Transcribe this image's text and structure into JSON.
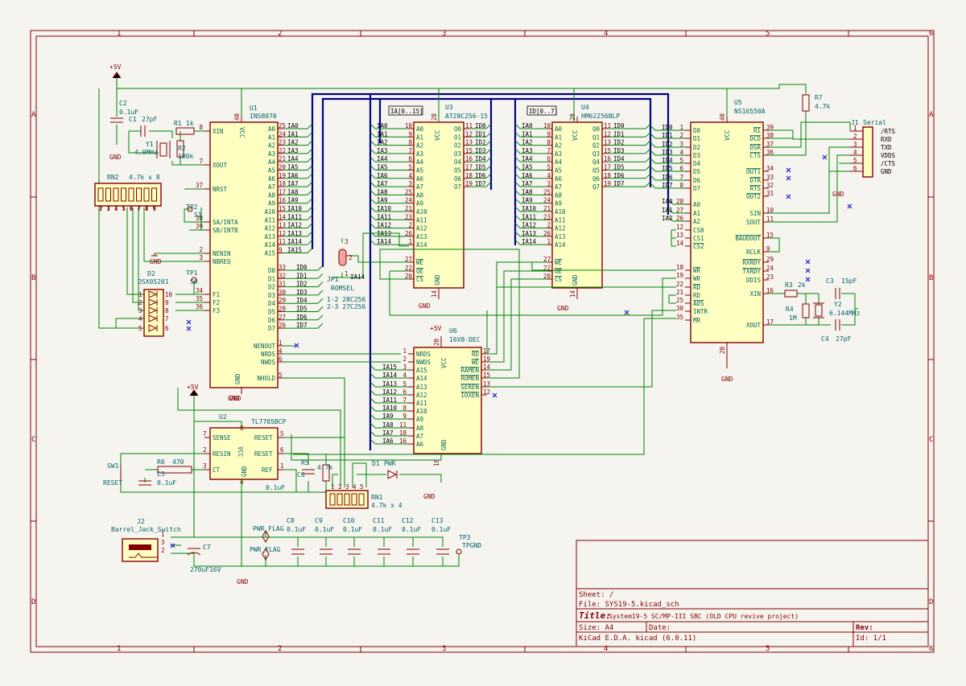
{
  "frame": {
    "columns": [
      "1",
      "2",
      "3",
      "4",
      "5",
      "6"
    ],
    "rows": [
      "A",
      "B",
      "C",
      "D"
    ]
  },
  "title_block": {
    "sheet": "Sheet: /",
    "file": "File: SYS19-5.kicad_sch",
    "title_label": "Title:",
    "title": "System19-5 SC/MP-III SBC (OLD CPU revive project)",
    "size": "Size: A4",
    "date": "Date:",
    "rev": "Rev:",
    "tool": "KiCad E.D.A.  kicad (6.0.11)",
    "id": "Id: 1/1"
  },
  "power": {
    "plus5v": "+5V",
    "gnd": "GND",
    "pwr_flag": "PWR_FLAG"
  },
  "components": {
    "u1": {
      "ref": "U1",
      "value": "INS8070"
    },
    "u3": {
      "ref": "U3",
      "value": "AT28C256-15"
    },
    "u4": {
      "ref": "U4",
      "value": "HM62256BLP"
    },
    "u5": {
      "ref": "U5",
      "value": "NS16550A"
    },
    "u6": {
      "ref": "U6",
      "value": "16V8-DEC"
    },
    "u2": {
      "ref": "U2",
      "value": "TL7705BCP"
    },
    "c1": {
      "ref": "C1",
      "value": "27pF"
    },
    "c2": {
      "ref": "C2",
      "value": "0.1uF"
    },
    "r1": {
      "ref": "R1",
      "value": "1k"
    },
    "r2": {
      "ref": "R2",
      "value": "100k"
    },
    "y1": {
      "ref": "Y1",
      "value": "4.0MHz"
    },
    "rn2": {
      "ref": "RN2",
      "value": "4.7k x 8"
    },
    "tp2": {
      "ref": "TP2",
      "value": "SI"
    },
    "tp1": {
      "ref": "TP1",
      "value": "SO"
    },
    "d2": {
      "ref": "D2",
      "value": "OSX05201"
    },
    "jp1": {
      "ref": "JP1",
      "value": "ROMSEL",
      "note1": "1-2 28C256",
      "note2": "2-3 27C256"
    },
    "r7": {
      "ref": "R7",
      "value": "4.7k"
    },
    "j1": {
      "ref": "J1",
      "value": "Serial"
    },
    "c3": {
      "ref": "C3",
      "value": "15pF"
    },
    "r3": {
      "ref": "R3",
      "value": "2k"
    },
    "r4": {
      "ref": "R4",
      "value": "1M"
    },
    "y2": {
      "ref": "Y2",
      "value": "6.144MHz"
    },
    "c4": {
      "ref": "C4",
      "value": "27pF"
    },
    "r6": {
      "ref": "R6",
      "value": "470"
    },
    "c5": {
      "ref": "C5",
      "value": "0.1uF"
    },
    "c6": {
      "ref": "C6",
      "value": "0.1uF"
    },
    "r5": {
      "ref": "R5",
      "value": "4.7k"
    },
    "sw1": {
      "ref": "SW1",
      "value": "RESET"
    },
    "d1": {
      "ref": "D1",
      "value": "PWR"
    },
    "rn1": {
      "ref": "RN1",
      "value": "4.7k x 4"
    },
    "j2": {
      "ref": "J2",
      "value": "Barrel_Jack_Switch"
    },
    "c7": {
      "ref": "C7",
      "value": "270uF16V"
    },
    "c8": {
      "ref": "C8",
      "value": "0.1uF"
    },
    "c9": {
      "ref": "C9",
      "value": "0.1uF"
    },
    "c10": {
      "ref": "C10",
      "value": "0.1uF"
    },
    "c11": {
      "ref": "C11",
      "value": "0.1uF"
    },
    "c12": {
      "ref": "C12",
      "value": "0.1uF"
    },
    "c13": {
      "ref": "C13",
      "value": "0.1uF"
    },
    "tp3": {
      "ref": "TP3",
      "value": "TPGND"
    }
  },
  "bus_labels": {
    "ia": "IA[0..15]",
    "id": "ID[0..7]"
  },
  "serial_signals": [
    "/RTS",
    "RXD",
    "TXD",
    "VDDS",
    "/CTS",
    "GND"
  ],
  "u1_left": [
    "XIN",
    "XOUT",
    "NRST",
    "SA/INTA",
    "SB/INTB",
    "NENIN",
    "NBREQ",
    "F1",
    "F2",
    "F3"
  ],
  "u1_left_pins": [
    "8",
    "7",
    "37",
    "38",
    "39",
    "2",
    "3",
    "34",
    "35",
    "36"
  ],
  "u1_right_addr_pins": [
    "25",
    "24",
    "23",
    "22",
    "21",
    "20",
    "19",
    "18",
    "17",
    "16",
    "15",
    "14",
    "13",
    "12",
    "11",
    "9"
  ],
  "u1_data_pins": [
    "33",
    "32",
    "31",
    "30",
    "29",
    "28",
    "27",
    "26"
  ],
  "u1_ctrl": [
    "NENOUT",
    "NRDS",
    "NWDS",
    "NHOLD"
  ],
  "u1_ctrl_pins": [
    "1",
    "4",
    "6",
    "5"
  ],
  "addr_labels": [
    "IA0",
    "IA1",
    "IA2",
    "IA3",
    "IA4",
    "IA5",
    "IA6",
    "IA7",
    "IA8",
    "IA9",
    "IA10",
    "IA11",
    "IA12",
    "IA13",
    "IA14",
    "IA15"
  ],
  "data_labels": [
    "ID0",
    "ID1",
    "ID2",
    "ID3",
    "ID4",
    "ID5",
    "ID6",
    "ID7"
  ],
  "mem_addr_pins": [
    "10",
    "9",
    "8",
    "7",
    "6",
    "5",
    "4",
    "3",
    "25",
    "24",
    "21",
    "23",
    "2",
    "26",
    "1"
  ],
  "mem_data_pins": [
    "11",
    "12",
    "13",
    "15",
    "16",
    "17",
    "18",
    "19"
  ],
  "mem_ctrl": [
    "WE",
    "OE",
    "CS"
  ],
  "u3_ctrl_pins": [
    "27",
    "22",
    "20"
  ],
  "u4_ctrl_pins": [
    "27",
    "22",
    "20"
  ],
  "u5_left": [
    "D0",
    "D1",
    "D2",
    "D3",
    "D4",
    "D5",
    "D6",
    "D7",
    "A0",
    "A1",
    "A2",
    "CS0",
    "CS1",
    "CS2",
    "WR",
    "WR",
    "RD",
    "RD",
    "ADS",
    "INTR",
    "MR"
  ],
  "u5_left_pins": [
    "1",
    "2",
    "3",
    "4",
    "5",
    "6",
    "7",
    "8",
    "28",
    "27",
    "26",
    "12",
    "13",
    "14",
    "18",
    "19",
    "22",
    "21",
    "25",
    "30",
    "35"
  ],
  "u5_right": [
    "RI",
    "DCD",
    "DSR",
    "CTS",
    "OUT1",
    "DTR",
    "RTS",
    "OUT2",
    "SIN",
    "SOUT",
    "BAUDOUT",
    "RCLK",
    "RXRDY",
    "TXRDY",
    "DDIS",
    "XIN",
    "XOUT"
  ],
  "u5_right_pins": [
    "39",
    "38",
    "37",
    "36",
    "34",
    "33",
    "32",
    "31",
    "10",
    "11",
    "15",
    "9",
    "29",
    "24",
    "23",
    "16",
    "17"
  ],
  "u6_left": [
    "NRDS",
    "NWDS",
    "IA15",
    "IA14",
    "IA13",
    "IA12",
    "IA11",
    "IA10",
    "IA9",
    "IA8",
    "IA7",
    "IA6"
  ],
  "u6_left_pins": [
    "1",
    "2",
    "3",
    "4",
    "5",
    "6",
    "7",
    "8",
    "9",
    "11",
    "18",
    "16"
  ],
  "u6_left_sig": [
    "A15",
    "A14",
    "A13",
    "A12",
    "A11",
    "A10",
    "A9",
    "A8",
    "A7",
    "A6"
  ],
  "u6_right": [
    "RD",
    "WE",
    "RAMEN",
    "ROMEN",
    "SEREN",
    "IOXEN"
  ],
  "u6_right_pins": [
    "17",
    "19",
    "14",
    "15",
    "13",
    "12"
  ],
  "u2_pins": {
    "sense": "SENSE",
    "resin": "RESIN",
    "ct": "CT",
    "reset_n": "RESET",
    "reset": "RESET",
    "ref": "REF"
  },
  "u2_pin_nums": {
    "sense": "7",
    "resin": "2",
    "ct": "3",
    "reset_n": "5",
    "reset": "6",
    "ref": "1",
    "vcc": "8",
    "gnd": "4"
  },
  "pin_misc": {
    "vcc": "VCC",
    "gnd": "GND",
    "p40": "40",
    "p20": "20",
    "p28": "28",
    "p14": "14",
    "p10": "10",
    "p8": "8",
    "p4": "4"
  }
}
